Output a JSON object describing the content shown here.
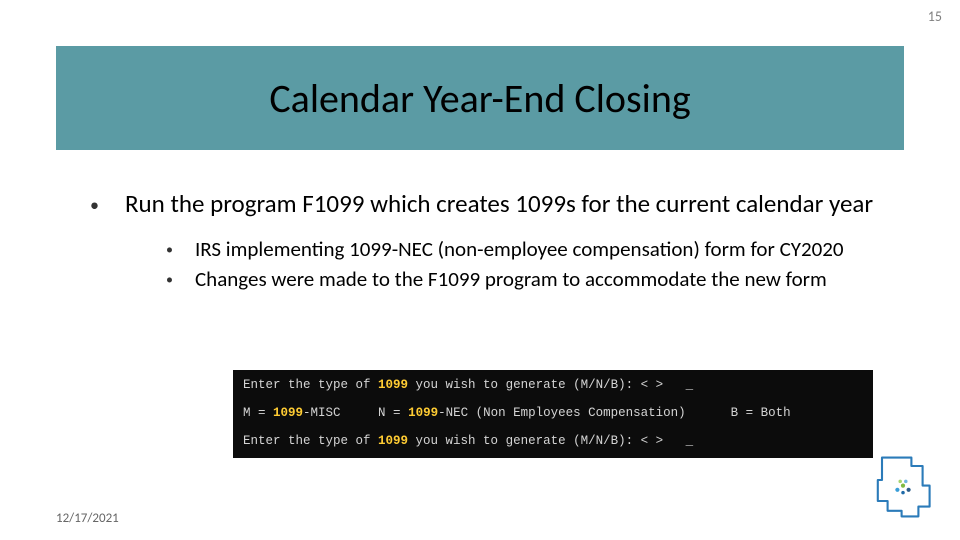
{
  "page_number": "15",
  "title": "Calendar Year-End Closing",
  "bullets": {
    "main": "Run the program F1099 which creates 1099s for the current calendar year",
    "sub1": "IRS implementing 1099-NEC (non-employee compensation) form for CY2020",
    "sub2": "Changes were made to the F1099 program to accommodate the new form"
  },
  "terminal": {
    "line1_a": "Enter the type of ",
    "line1_hl": "1099",
    "line1_b": " you wish to generate (M/N/B): < >   _",
    "line2_a": "M = ",
    "line2_hl1": "1099",
    "line2_b": "-MISC     N = ",
    "line2_hl2": "1099",
    "line2_c": "-NEC (Non Employees Compensation)      B = Both",
    "line3_a": "Enter the type of ",
    "line3_hl": "1099",
    "line3_b": " you wish to generate (M/N/B): < >   _"
  },
  "footer_date": "12/17/2021"
}
